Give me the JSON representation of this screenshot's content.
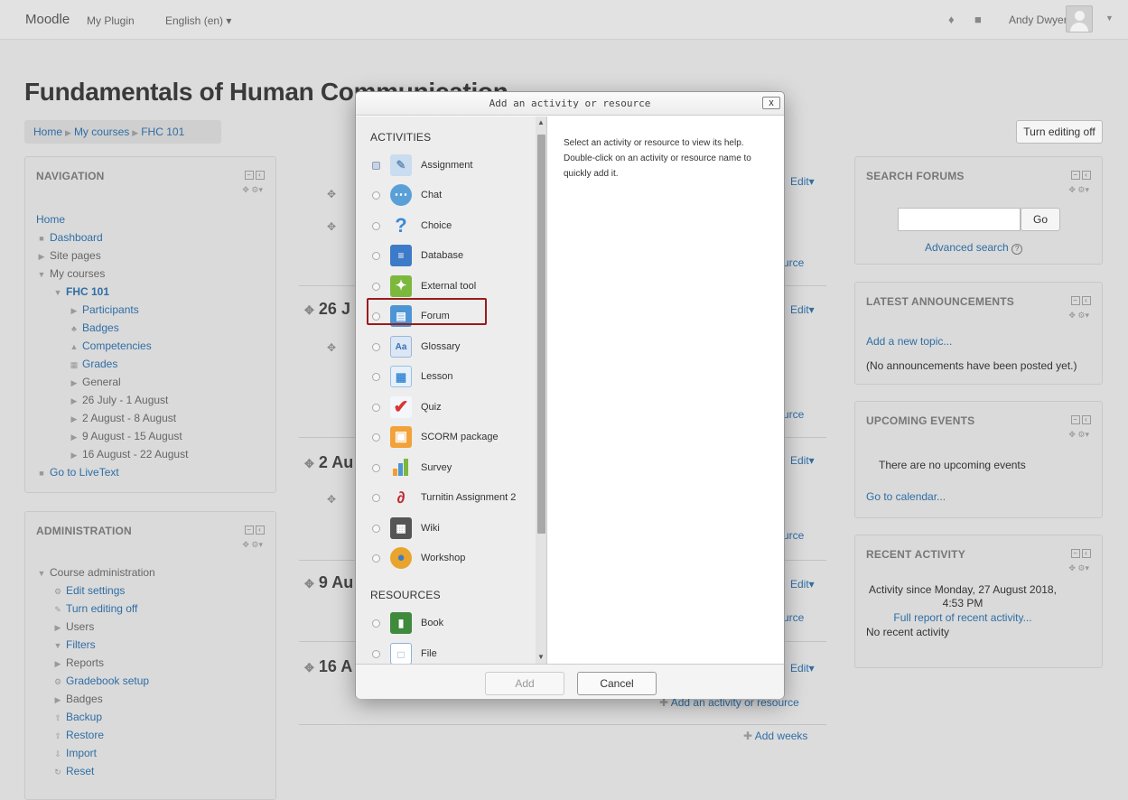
{
  "navbar": {
    "brand": "Moodle",
    "plugin": "My Plugin",
    "language": "English (en) ▾",
    "user": "Andy Dwyer"
  },
  "page": {
    "title": "Fundamentals of Human Communication",
    "breadcrumb": [
      "Home",
      "My courses",
      "FHC 101"
    ],
    "turn_editing_off": "Turn editing off"
  },
  "navigation": {
    "title": "NAVIGATION",
    "items": [
      "Home",
      "Dashboard",
      "Site pages",
      "My courses",
      "FHC 101",
      "Participants",
      "Badges",
      "Competencies",
      "Grades",
      "General",
      "26 July - 1 August",
      "2 August - 8 August",
      "9 August - 15 August",
      "16 August - 22 August",
      "Go to LiveText"
    ]
  },
  "administration": {
    "title": "ADMINISTRATION",
    "items": [
      "Course administration",
      "Edit settings",
      "Turn editing off",
      "Users",
      "Filters",
      "Reports",
      "Gradebook setup",
      "Badges",
      "Backup",
      "Restore",
      "Import",
      "Reset"
    ]
  },
  "course": {
    "sections": [
      "26 J",
      "2 Au",
      "9 Au",
      "16 A"
    ],
    "edit_label": "Edit▾",
    "resource_fragment": "urce",
    "add_activity": "Add an activity or resource",
    "add_weeks": "Add weeks"
  },
  "search_forums": {
    "title": "SEARCH FORUMS",
    "go": "Go",
    "advanced": "Advanced search",
    "query": ""
  },
  "announcements": {
    "title": "LATEST ANNOUNCEMENTS",
    "add": "Add a new topic...",
    "none": "(No announcements have been posted yet.)"
  },
  "events": {
    "title": "UPCOMING EVENTS",
    "none": "There are no upcoming events",
    "calendar": "Go to calendar..."
  },
  "recent": {
    "title": "RECENT ACTIVITY",
    "since": "Activity since Monday, 27 August 2018, 4:53 PM",
    "full_report": "Full report of recent activity...",
    "none": "No recent activity"
  },
  "modal": {
    "title": "Add an activity or resource",
    "close": "x",
    "activities_heading": "ACTIVITIES",
    "activities": [
      "Assignment",
      "Chat",
      "Choice",
      "Database",
      "External tool",
      "Forum",
      "Glossary",
      "Lesson",
      "Quiz",
      "SCORM package",
      "Survey",
      "Turnitin Assignment 2",
      "Wiki",
      "Workshop"
    ],
    "resources_heading": "RESOURCES",
    "resources": [
      "Book",
      "File"
    ],
    "help_text": "Select an activity or resource to view its help. Double-click on an activity or resource name to quickly add it.",
    "add_button": "Add",
    "cancel_button": "Cancel",
    "highlight_color": "#9b1b1b"
  }
}
